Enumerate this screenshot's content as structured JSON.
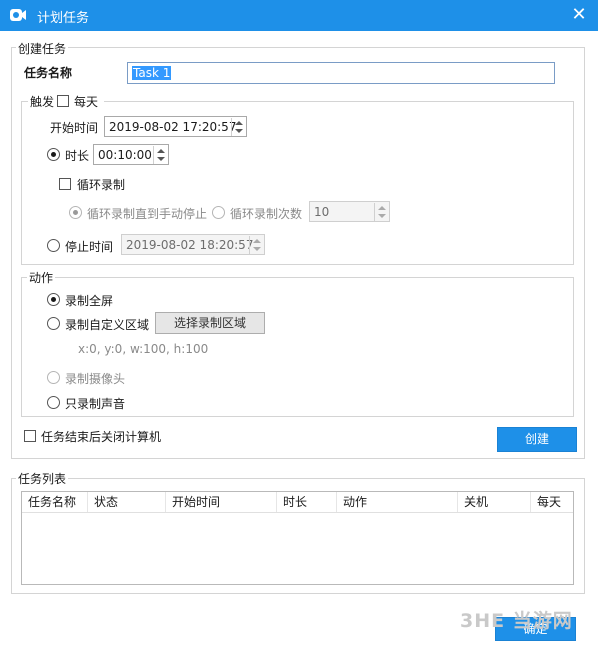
{
  "window": {
    "title": "计划任务",
    "close_glyph": "✕"
  },
  "create_group": {
    "legend": "创建任务",
    "task_name_label": "任务名称",
    "task_name_value": "Task 1",
    "trigger": {
      "legend": "触发",
      "everyday_label": "每天",
      "everyday_checked": false,
      "start_time_label": "开始时间",
      "start_time_value": "2019-08-02 17:20:57",
      "duration_label": "时长",
      "duration_value": "00:10:00",
      "duration_selected": true,
      "loop_label": "循环录制",
      "loop_checked": false,
      "loop_until_stop_label": "循环录制直到手动停止",
      "loop_count_label": "循环录制次数",
      "loop_count_value": "10",
      "stop_time_label": "停止时间",
      "stop_time_value": "2019-08-02 18:20:57"
    },
    "action": {
      "legend": "动作",
      "fullscreen_label": "录制全屏",
      "custom_region_label": "录制自定义区域",
      "select_region_button": "选择录制区域",
      "region_coords": "x:0, y:0, w:100, h:100",
      "camera_label": "录制摄像头",
      "audio_only_label": "只录制声音",
      "selected": "fullscreen"
    },
    "shutdown_label": "任务结束后关闭计算机",
    "shutdown_checked": false,
    "create_button": "创建"
  },
  "task_list": {
    "legend": "任务列表",
    "columns": [
      "任务名称",
      "状态",
      "开始时间",
      "时长",
      "动作",
      "关机",
      "每天"
    ],
    "rows": []
  },
  "ok_button": "确定",
  "watermark": "3HE 当游网",
  "colors": {
    "accent": "#1e90e8",
    "selection": "#3399ff"
  }
}
